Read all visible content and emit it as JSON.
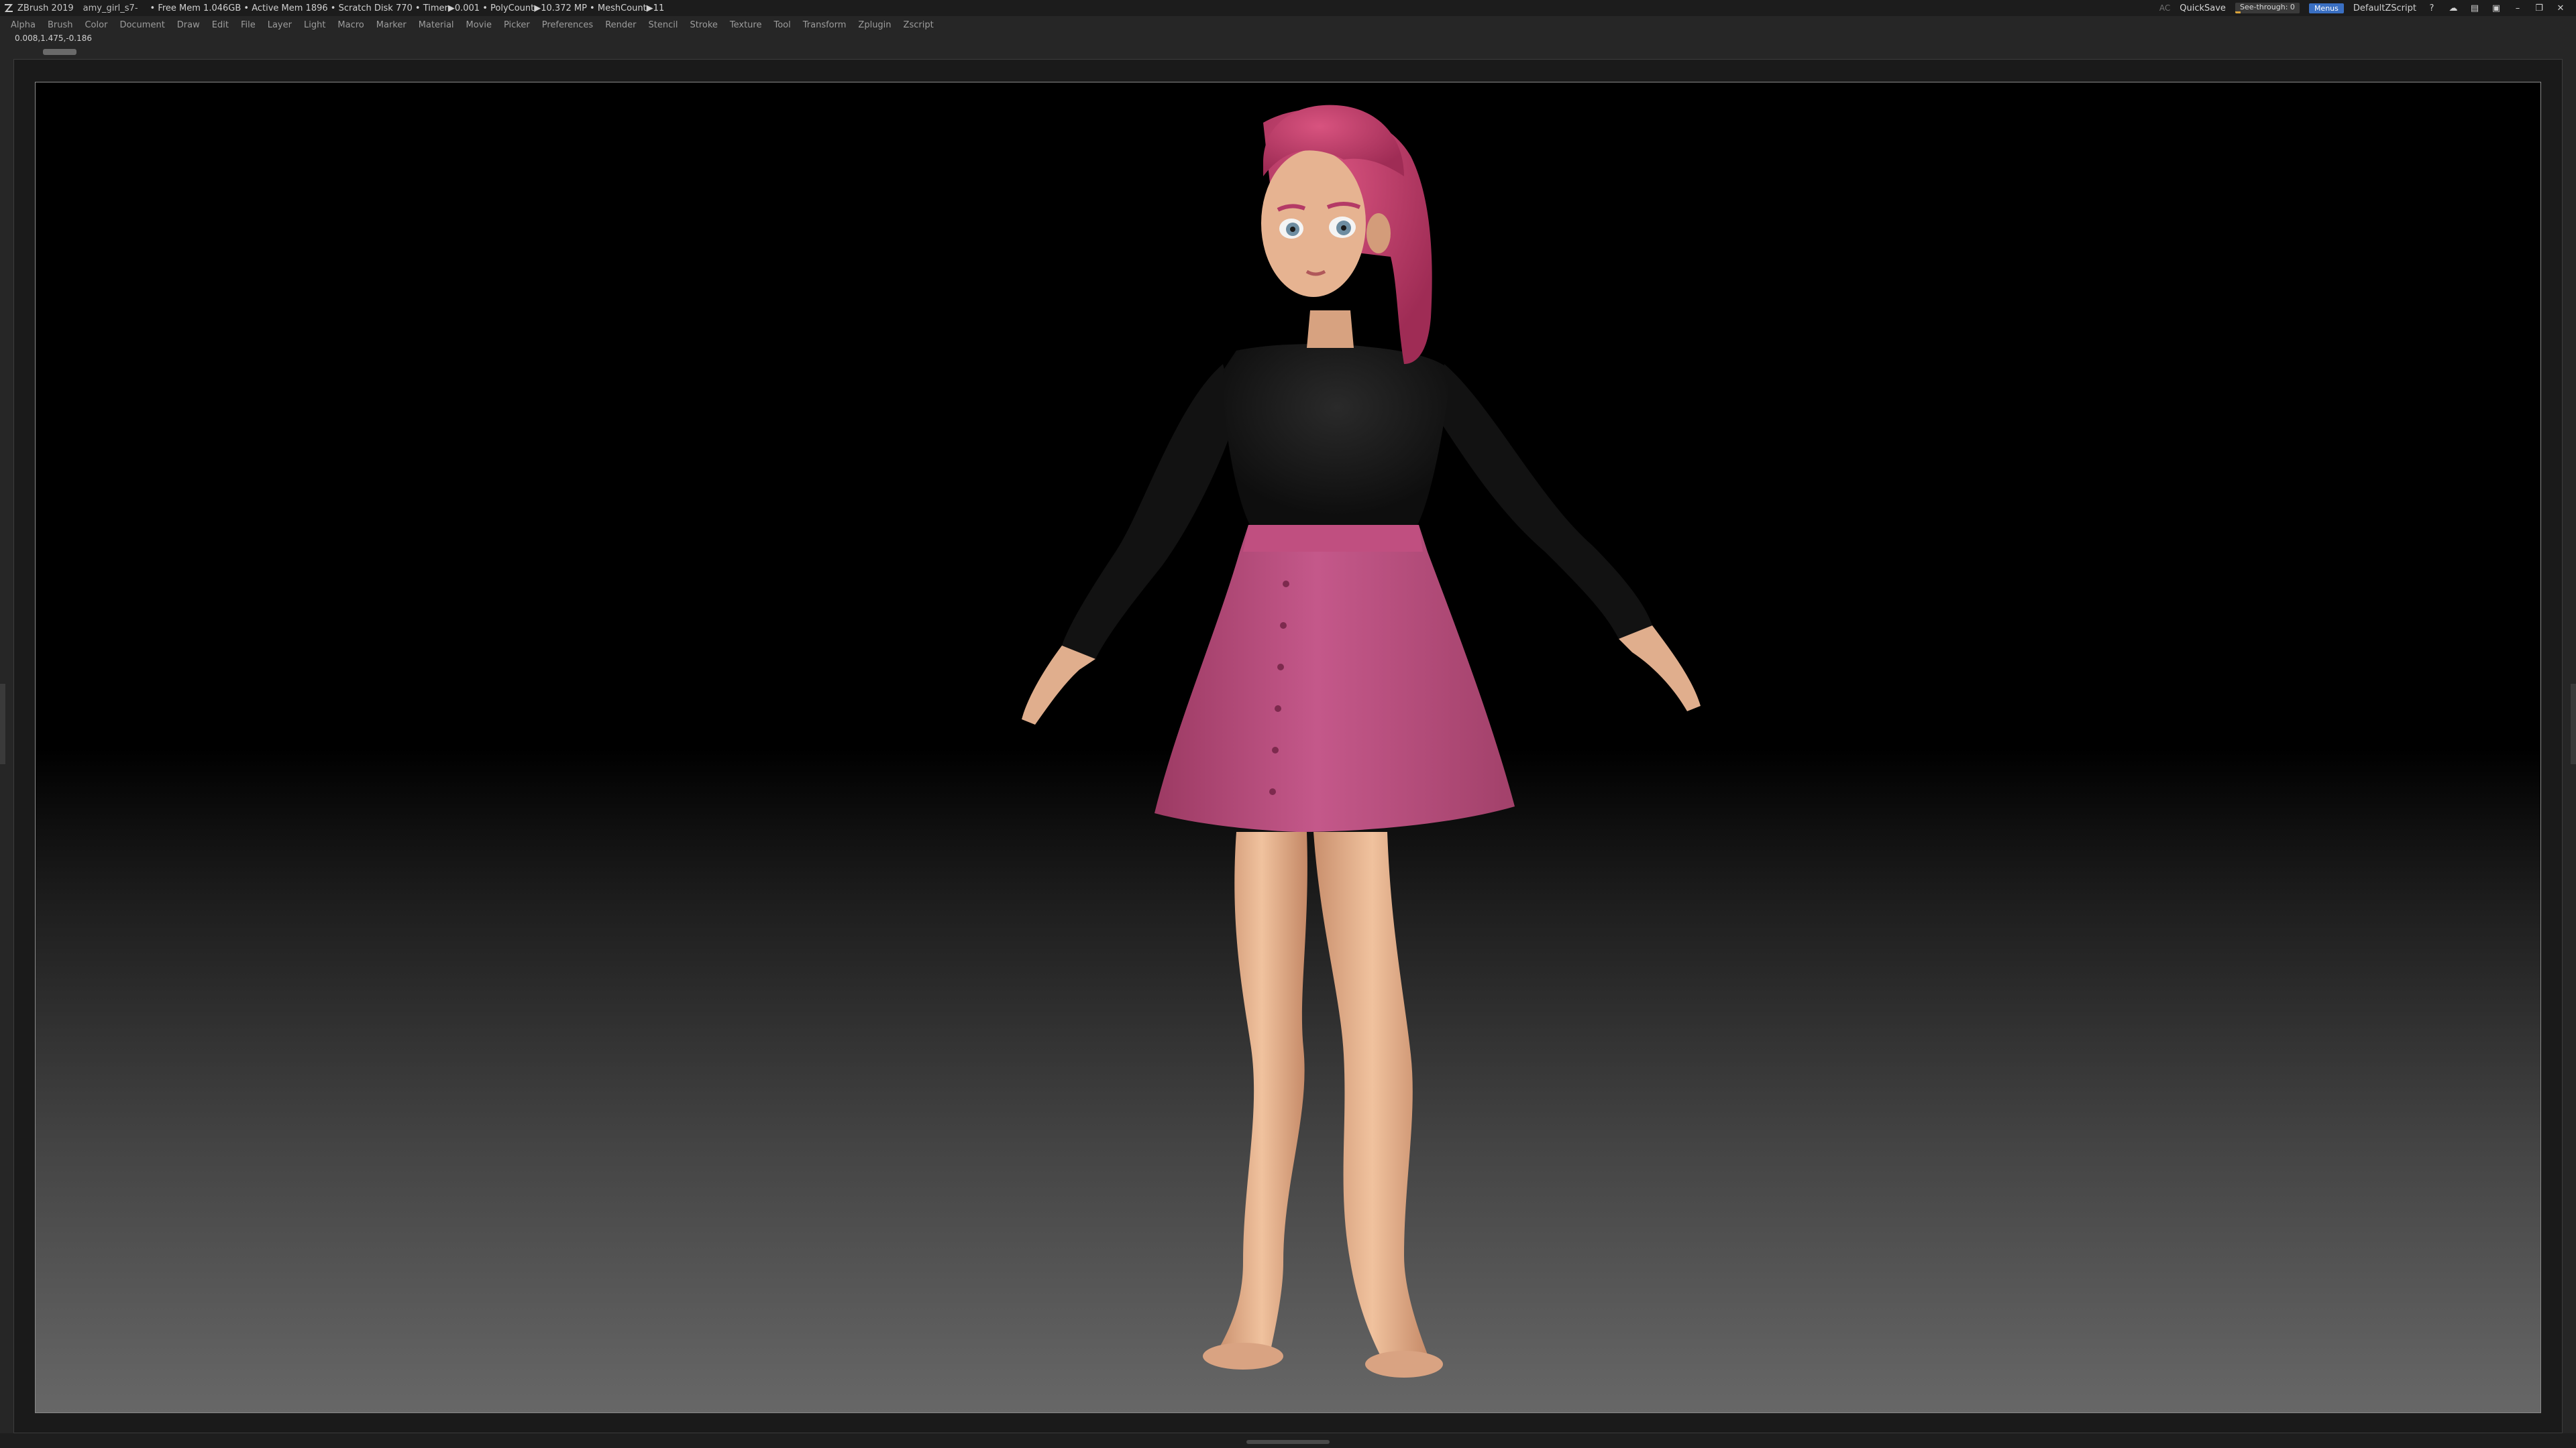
{
  "titlebar": {
    "app": "ZBrush 2019",
    "document": "amy_girl_s7-",
    "stats": "• Free Mem 1.046GB • Active Mem 1896 • Scratch Disk 770 • Timer▶0.001 • PolyCount▶10.372 MP • MeshCount▶11",
    "ac": "AC",
    "quicksave": "QuickSave",
    "see_through_label": "See-through",
    "see_through_value": "0",
    "see_through_level": 0,
    "menus": "Menus",
    "script": "DefaultZScript"
  },
  "menubar": {
    "items": [
      "Alpha",
      "Brush",
      "Color",
      "Document",
      "Draw",
      "Edit",
      "File",
      "Layer",
      "Light",
      "Macro",
      "Marker",
      "Material",
      "Movie",
      "Picker",
      "Preferences",
      "Render",
      "Stencil",
      "Stroke",
      "Texture",
      "Tool",
      "Transform",
      "Zplugin",
      "Zscript"
    ]
  },
  "coords": "0.008,1.475,-0.186",
  "icons": {
    "logo": "zbrush-logo-icon",
    "window": [
      "help-icon",
      "cloud-icon",
      "layout-icon",
      "lock-icon",
      "minimize-icon",
      "restore-icon",
      "close-icon"
    ]
  },
  "colors": {
    "skirt": "#b64a78",
    "top": "#151515",
    "hair": "#c23d6a",
    "skin": "#e8b692",
    "menus_active": "#3a6fc2"
  }
}
